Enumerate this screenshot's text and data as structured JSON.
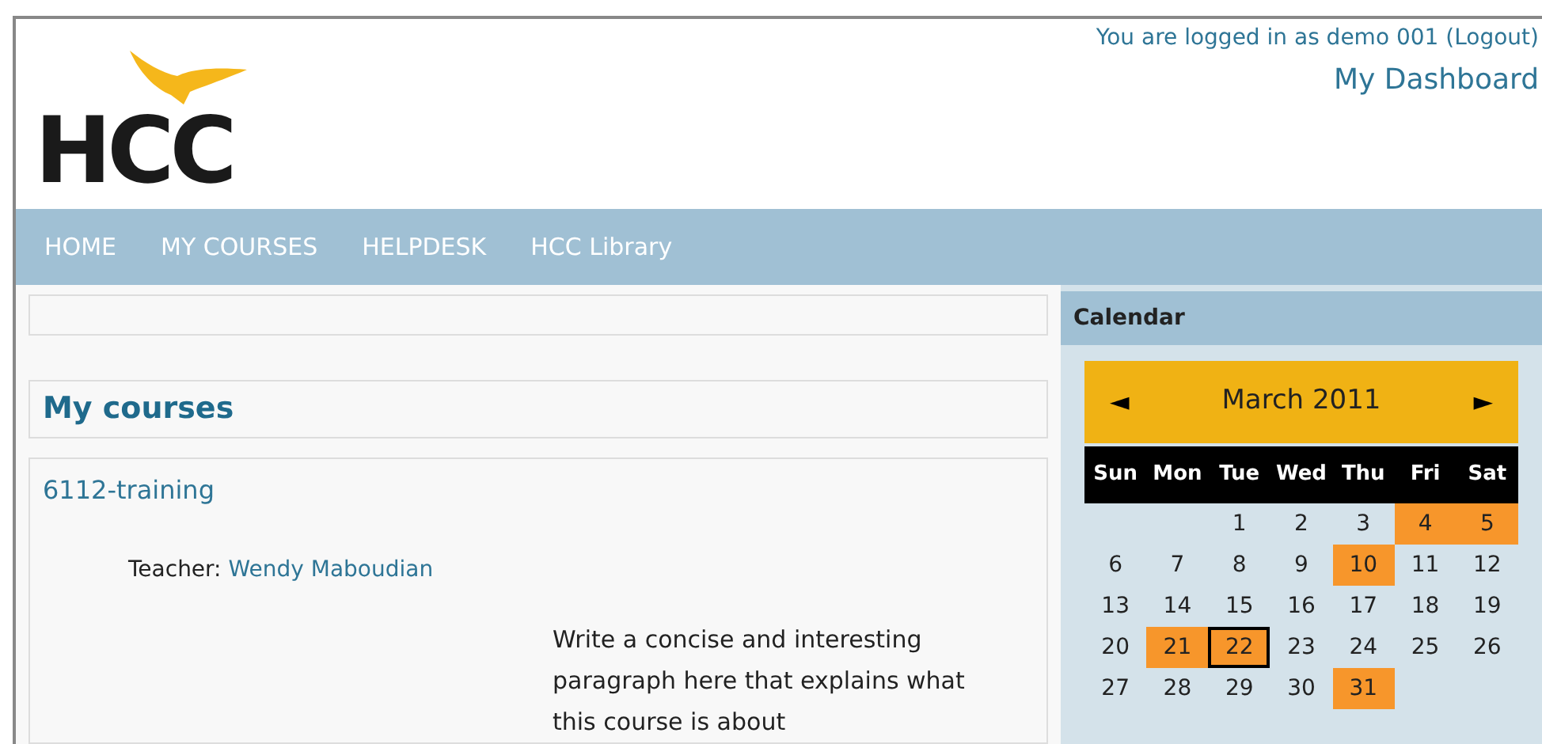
{
  "header": {
    "logo": "HCC",
    "user_info": "You are logged in as demo 001",
    "logout": "(Logout)",
    "dashboard_link": "My Dashboard"
  },
  "nav": [
    "HOME",
    "MY COURSES",
    "HELPDESK",
    "HCC Library"
  ],
  "my_courses": {
    "title": "My courses",
    "courses": [
      {
        "name": "6112-training",
        "teacher_label": "Teacher:",
        "teacher": "Wendy Maboudian",
        "summary": "Write a concise and interesting paragraph here that explains what this course is about"
      }
    ]
  },
  "calendar": {
    "title": "Calendar",
    "prev": "◄",
    "next": "►",
    "month": "March 2011",
    "weekdays": [
      "Sun",
      "Mon",
      "Tue",
      "Wed",
      "Thu",
      "Fri",
      "Sat"
    ],
    "weeks": [
      [
        {
          "day": "1",
          "event": false,
          "today": false
        },
        {
          "day": "2",
          "event": false,
          "today": false
        },
        {
          "day": "3",
          "event": false,
          "today": false
        },
        {
          "day": "4",
          "event": true,
          "today": false
        },
        {
          "day": "5",
          "event": true,
          "today": false
        }
      ],
      [
        {
          "day": "6",
          "event": false,
          "today": false
        },
        {
          "day": "7",
          "event": false,
          "today": false
        },
        {
          "day": "8",
          "event": false,
          "today": false
        },
        {
          "day": "9",
          "event": false,
          "today": false
        },
        {
          "day": "10",
          "event": true,
          "today": false
        },
        {
          "day": "11",
          "event": false,
          "today": false
        },
        {
          "day": "12",
          "event": false,
          "today": false
        }
      ],
      [
        {
          "day": "13",
          "event": false,
          "today": false
        },
        {
          "day": "14",
          "event": false,
          "today": false
        },
        {
          "day": "15",
          "event": false,
          "today": false
        },
        {
          "day": "16",
          "event": false,
          "today": false
        },
        {
          "day": "17",
          "event": false,
          "today": false
        },
        {
          "day": "18",
          "event": false,
          "today": false
        },
        {
          "day": "19",
          "event": false,
          "today": false
        }
      ],
      [
        {
          "day": "20",
          "event": false,
          "today": false
        },
        {
          "day": "21",
          "event": true,
          "today": false
        },
        {
          "day": "22",
          "event": true,
          "today": true
        },
        {
          "day": "23",
          "event": false,
          "today": false
        },
        {
          "day": "24",
          "event": false,
          "today": false
        },
        {
          "day": "25",
          "event": false,
          "today": false
        },
        {
          "day": "26",
          "event": false,
          "today": false
        }
      ],
      [
        {
          "day": "27",
          "event": false,
          "today": false
        },
        {
          "day": "28",
          "event": false,
          "today": false
        },
        {
          "day": "29",
          "event": false,
          "today": false
        },
        {
          "day": "30",
          "event": false,
          "today": false
        },
        {
          "day": "31",
          "event": true,
          "today": false
        }
      ]
    ]
  }
}
